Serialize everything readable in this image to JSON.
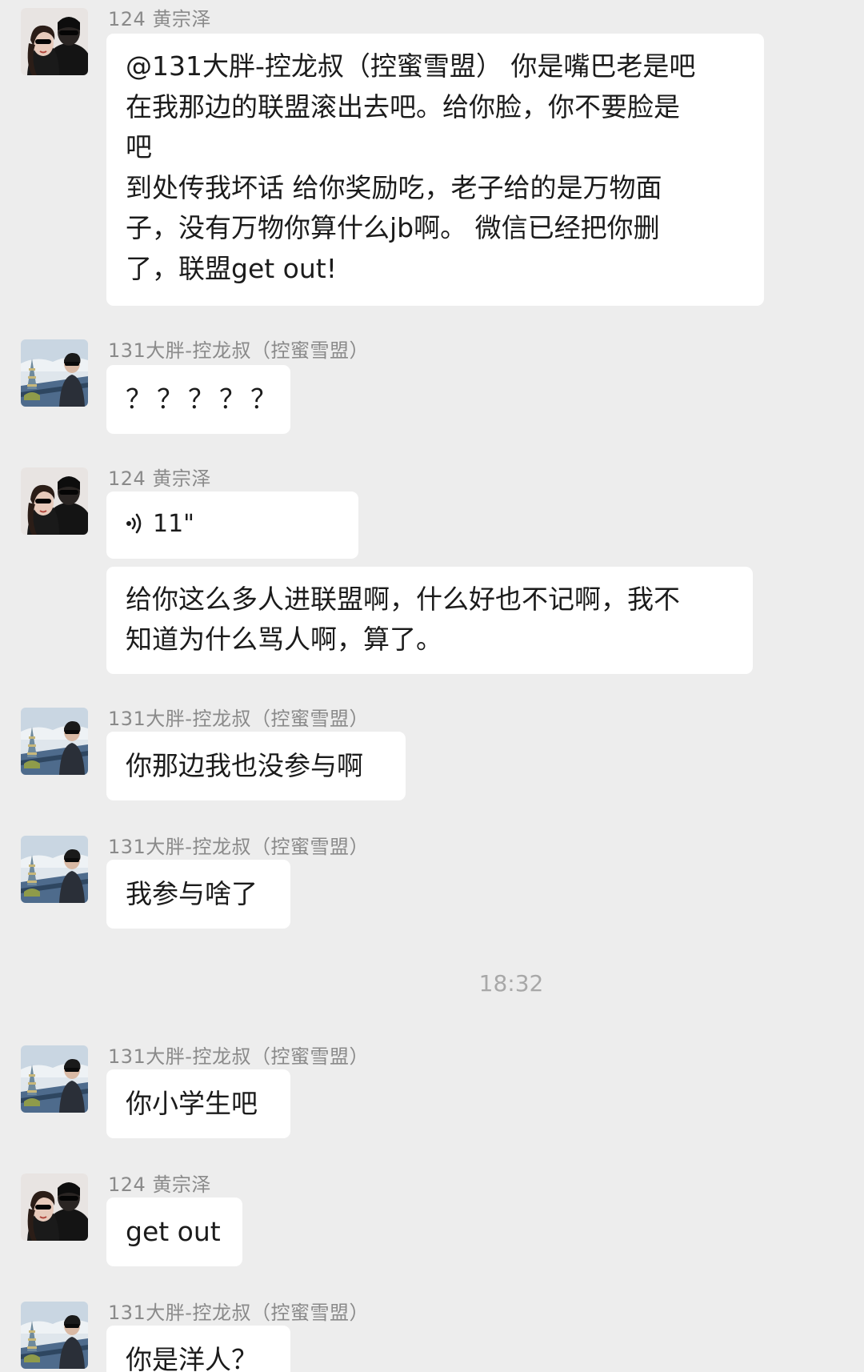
{
  "chat": {
    "timestamp": "18:32",
    "messages": [
      {
        "sender": "124 黄宗泽",
        "avatar": "couple-avatar",
        "lines": [
          "@131大胖-控龙叔（控蜜雪盟） 你是嘴巴老是吧",
          "在我那边的联盟滚出去吧。给你脸，你不要脸是",
          "吧",
          "到处传我坏话 给你奖励吃，老子给的是万物面",
          "子，没有万物你算什么jb啊。 微信已经把你删",
          "了，联盟get out!"
        ]
      },
      {
        "sender": "131大胖-控龙叔（控蜜雪盟）",
        "avatar": "tower-avatar",
        "lines": [
          "？？？？？"
        ]
      },
      {
        "sender": "124 黄宗泽",
        "avatar": "couple-avatar",
        "voice": {
          "duration": "11\"",
          "icon": "voice-wave-icon"
        },
        "lines": [
          "给你这么多人进联盟啊，什么好也不记啊，我不",
          "知道为什么骂人啊，算了。"
        ]
      },
      {
        "sender": "131大胖-控龙叔（控蜜雪盟）",
        "avatar": "tower-avatar",
        "lines": [
          "你那边我也没参与啊"
        ]
      },
      {
        "sender": "131大胖-控龙叔（控蜜雪盟）",
        "avatar": "tower-avatar",
        "lines": [
          "我参与啥了"
        ]
      },
      {
        "sender": "131大胖-控龙叔（控蜜雪盟）",
        "avatar": "tower-avatar",
        "lines": [
          "你小学生吧"
        ]
      },
      {
        "sender": "124 黄宗泽",
        "avatar": "couple-avatar",
        "lines": [
          "get out"
        ]
      },
      {
        "sender": "131大胖-控龙叔（控蜜雪盟）",
        "avatar": "tower-avatar",
        "lines": [
          "你是洋人？"
        ]
      }
    ]
  },
  "colors": {
    "background": "#ededed",
    "bubble": "#ffffff",
    "sender_text": "#8a8a8a",
    "message_text": "#1b1b1b",
    "timestamp_text": "#a8a8a8"
  }
}
